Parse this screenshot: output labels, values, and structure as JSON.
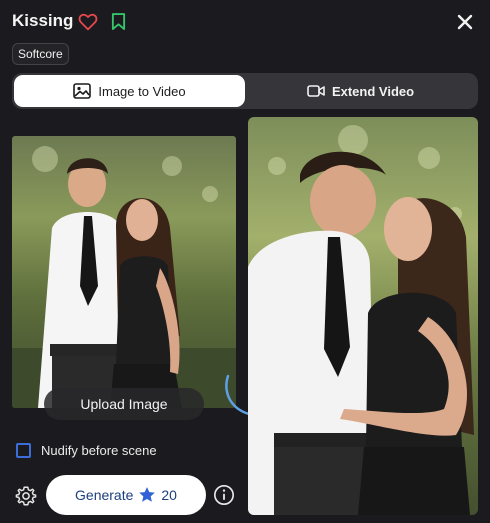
{
  "header": {
    "title": "Kissing",
    "icons": {
      "favorite": "heart-icon",
      "save": "bookmark-icon",
      "close": "close-icon"
    },
    "colors": {
      "heart": "#e5484d",
      "bookmark": "#35c46a"
    }
  },
  "tag": {
    "label": "Softcore"
  },
  "tabs": [
    {
      "label": "Image to Video",
      "icon": "image-icon",
      "active": true
    },
    {
      "label": "Extend Video",
      "icon": "video-camera-icon",
      "active": false
    }
  ],
  "upload": {
    "label": "Upload Image"
  },
  "nudify": {
    "label": "Nudify before scene",
    "checked": false
  },
  "generate": {
    "label": "Generate",
    "cost": "20",
    "icon": "star-icon",
    "accent": "#2f62d6"
  }
}
